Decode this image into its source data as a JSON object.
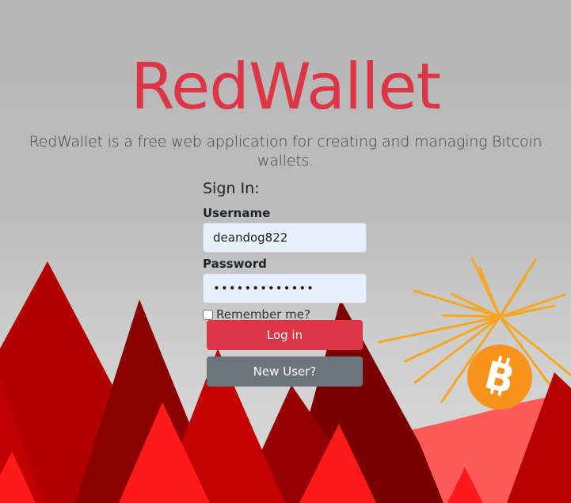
{
  "app": {
    "title": "RedWallet",
    "tagline": "RedWallet is a free web application for creating and managing Bitcoin wallets."
  },
  "signin": {
    "heading": "Sign In:",
    "username_label": "Username",
    "username_value": "deandog822",
    "password_label": "Password",
    "password_value": "•••••••••••••",
    "remember_label": "Remember me?",
    "login_label": "Log in",
    "new_user_label": "New User?"
  },
  "colors": {
    "accent": "#dc3545",
    "secondary": "#6c757d",
    "bitcoin": "#f7931a"
  },
  "icons": {
    "bitcoin": "bitcoin-logo-icon"
  }
}
